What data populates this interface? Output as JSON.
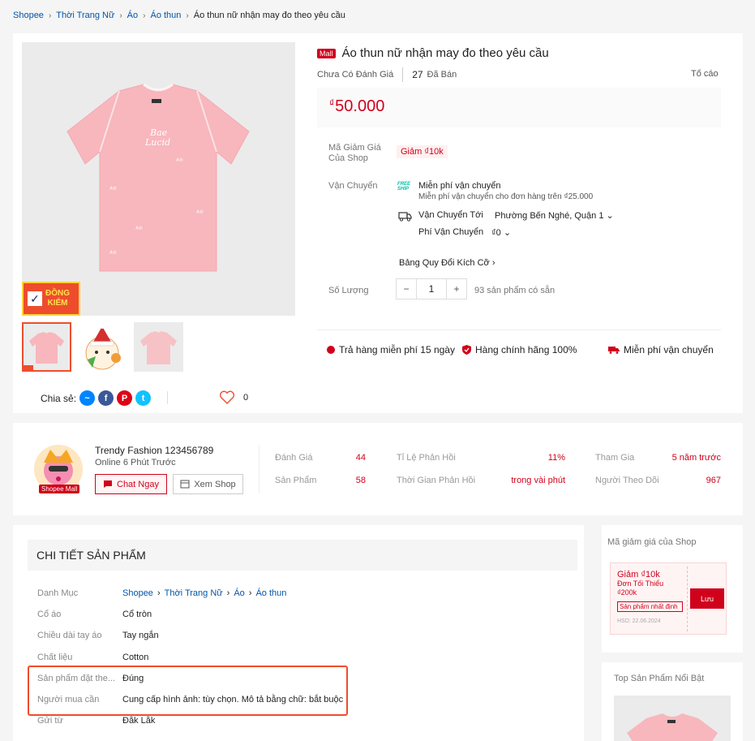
{
  "breadcrumb": [
    "Shopee",
    "Thời Trang Nữ",
    "Áo",
    "Áo thun",
    "Áo thun nữ nhận may đo theo yêu cầu"
  ],
  "product": {
    "mall_tag": "Mall",
    "title": "Áo thun nữ nhận may đo theo yêu cầu",
    "rating_text": "Chưa Có Đánh Giá",
    "sold_count": "27",
    "sold_label": "Đã Bán",
    "report": "Tố cáo",
    "currency": "₫",
    "price": "50.000",
    "badge_line1": "ĐỒNG",
    "badge_line2": "KIỂM"
  },
  "voucher": {
    "label_line1": "Mã Giảm Giá",
    "label_line2": "Của Shop",
    "chip": "Giảm ₫10k"
  },
  "shipping": {
    "label": "Vận Chuyển",
    "free_icon_line1": "FREE",
    "free_icon_line2": "SHIP",
    "free_title": "Miễn phí vận chuyển",
    "free_sub": "Miễn phí vận chuyển cho đơn hàng trên ₫25.000",
    "to_label": "Vận Chuyển Tới",
    "to_value": "Phường Bến Nghé, Quận 1",
    "fee_label": "Phí Vận Chuyển",
    "fee_value": "₫0"
  },
  "size_guide": "Bảng Quy Đổi Kích Cỡ",
  "quantity": {
    "label": "Số Lượng",
    "minus": "−",
    "value": "1",
    "plus": "+",
    "stock": "93 sản phẩm có sẵn"
  },
  "guarantees": [
    "Trả hàng miễn phí 15 ngày",
    "Hàng chính hãng 100%",
    "Miễn phí vận chuyển"
  ],
  "share": {
    "label": "Chia sẻ:",
    "like_count": "0"
  },
  "shop": {
    "name": "Trendy Fashion 123456789",
    "online": "Online 6 Phút Trước",
    "mall_badge": "Shopee Mall",
    "chat_btn": "Chat Ngay",
    "view_btn": "Xem Shop",
    "stats": [
      {
        "label": "Đánh Giá",
        "value": "44"
      },
      {
        "label": "Sản Phẩm",
        "value": "58"
      },
      {
        "label": "Tỉ Lệ Phản Hồi",
        "value": "11%"
      },
      {
        "label": "Thời Gian Phản Hồi",
        "value": "trong vài phút"
      },
      {
        "label": "Tham Gia",
        "value": "5 năm trước"
      },
      {
        "label": "Người Theo Dõi",
        "value": "967"
      }
    ]
  },
  "details": {
    "header": "CHI TIẾT SẢN PHẨM",
    "category_label": "Danh Mục",
    "category_path": [
      "Shopee",
      "Thời Trang Nữ",
      "Áo",
      "Áo thun"
    ],
    "rows": [
      {
        "label": "Cổ áo",
        "value": "Cổ tròn"
      },
      {
        "label": "Chiều dài tay áo",
        "value": "Tay ngắn"
      },
      {
        "label": "Chất liệu",
        "value": "Cotton"
      },
      {
        "label": "Sản phẩm đặt the...",
        "value": "Đúng"
      },
      {
        "label": "Người mua cần",
        "value": "Cung cấp hình ảnh: tùy chọn. Mô tả bằng chữ: bắt buộc"
      },
      {
        "label": "Gửi từ",
        "value": "Đắk Lắk"
      }
    ]
  },
  "shop_voucher": {
    "title": "Mã giảm giá của Shop",
    "amount": "Giảm ₫10k",
    "min_line1": "Đơn Tối Thiểu",
    "min_line2": "₫200k",
    "tag": "Sản phẩm nhất định",
    "expiry": "HSD: 22.06.2024",
    "save": "Lưu"
  },
  "top_products": {
    "title": "Top Sản Phẩm Nổi Bật"
  },
  "colors": {
    "accent": "#d0011b",
    "orange": "#ee4d2d",
    "link": "#05a",
    "shirt": "#f7b7bd"
  }
}
